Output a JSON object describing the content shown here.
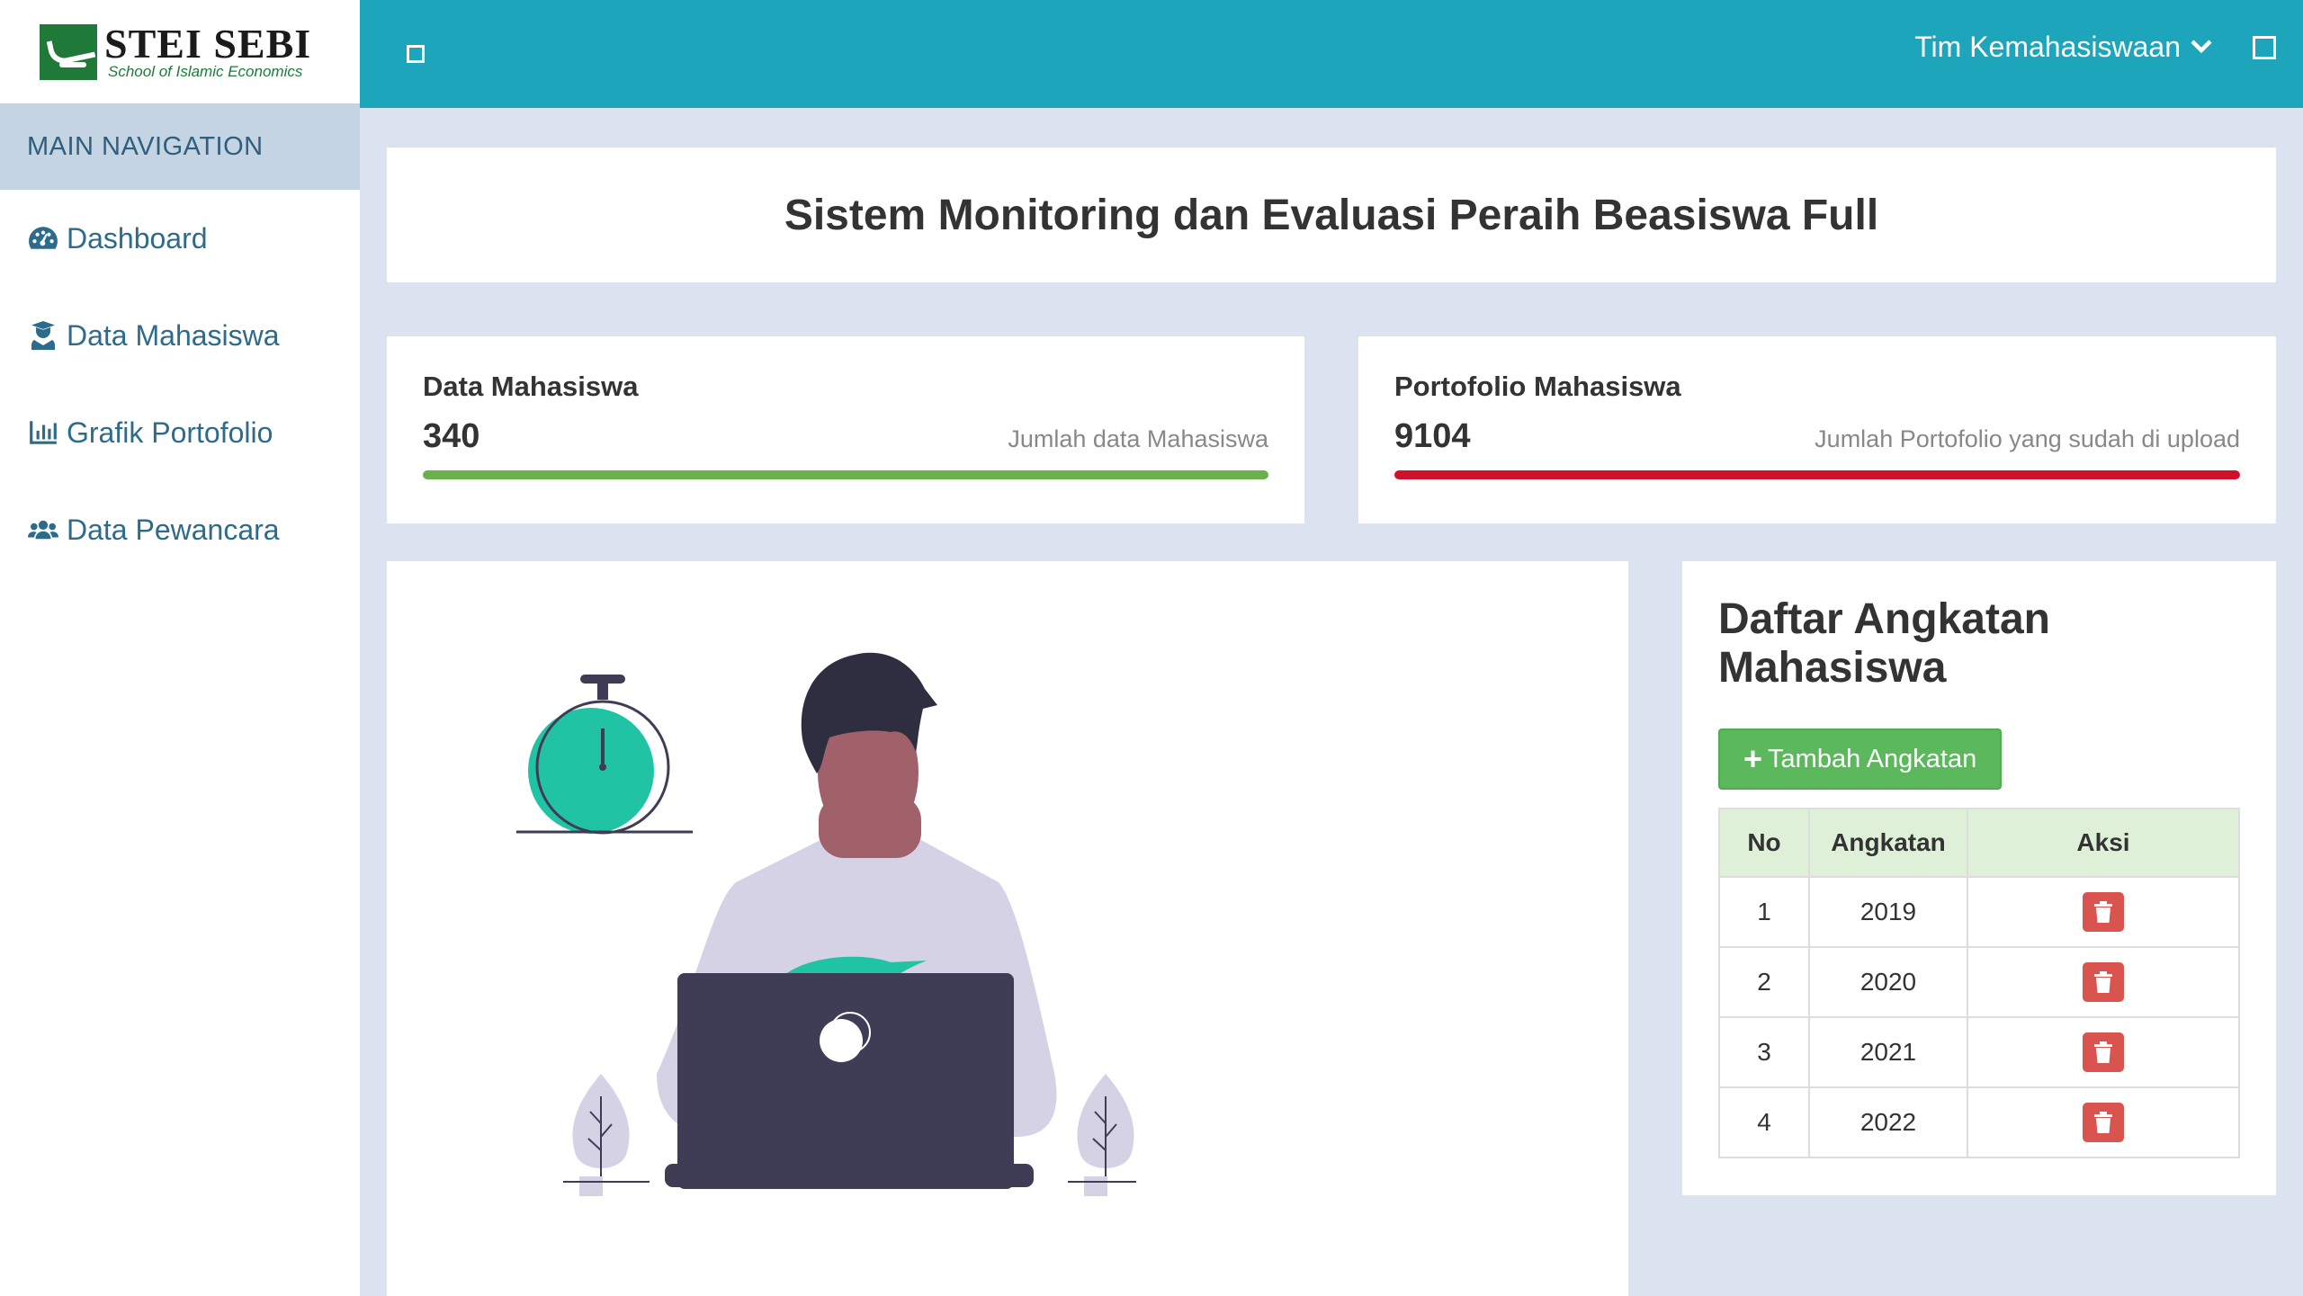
{
  "brand": {
    "title": "STEI SEBI",
    "subtitle": "School of Islamic Economics"
  },
  "sidebar": {
    "header": "MAIN NAVIGATION",
    "items": [
      {
        "label": "Dashboard",
        "icon": "tachometer-icon"
      },
      {
        "label": "Data Mahasiswa",
        "icon": "user-graduate-icon"
      },
      {
        "label": "Grafik Portofolio",
        "icon": "bar-chart-icon"
      },
      {
        "label": "Data Pewancara",
        "icon": "users-icon"
      }
    ]
  },
  "topbar": {
    "user_name": "Tim Kemahasiswaan"
  },
  "page": {
    "title": "Sistem Monitoring dan Evaluasi Peraih Beasiswa Full"
  },
  "stats": [
    {
      "label": "Data Mahasiswa",
      "value": "340",
      "desc": "Jumlah data Mahasiswa",
      "color": "#6ab04c"
    },
    {
      "label": "Portofolio Mahasiswa",
      "value": "9104",
      "desc": "Jumlah Portofolio yang sudah di upload",
      "color": "#d0112b"
    }
  ],
  "angkatan": {
    "title": "Daftar Angkatan Mahasiswa",
    "add_label": "Tambah Angkatan",
    "columns": [
      "No",
      "Angkatan",
      "Aksi"
    ],
    "rows": [
      {
        "no": "1",
        "angkatan": "2019"
      },
      {
        "no": "2",
        "angkatan": "2020"
      },
      {
        "no": "3",
        "angkatan": "2021"
      },
      {
        "no": "4",
        "angkatan": "2022"
      }
    ]
  },
  "colors": {
    "topbar": "#1da6bb",
    "accent_green": "#5cb85c",
    "danger": "#d9534f",
    "illustration_teal": "#20c3a4",
    "laptop": "#3f3d56"
  }
}
